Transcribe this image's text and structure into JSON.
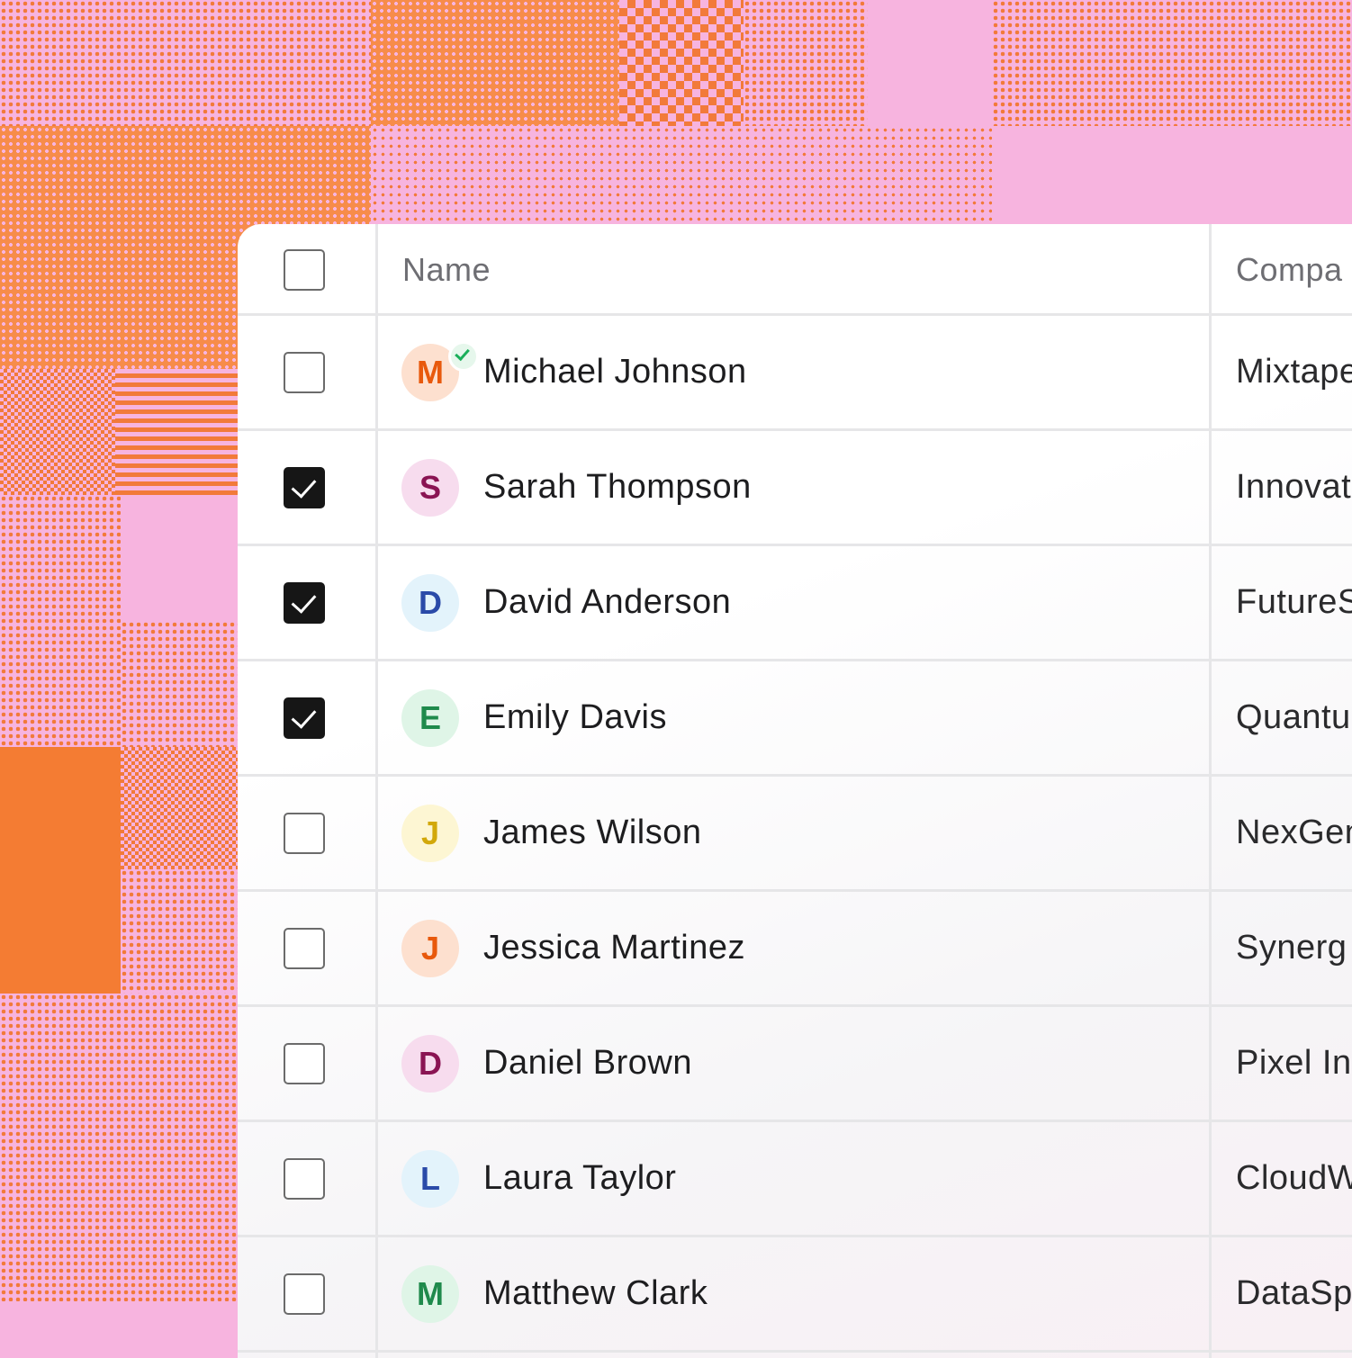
{
  "table": {
    "columns": {
      "name": "Name",
      "company": "Compa"
    },
    "rows": [
      {
        "name": "Michael Johnson",
        "initial": "M",
        "company": "Mixtape",
        "checked": false,
        "verified": true,
        "avatar_bg": "#fde0cf",
        "avatar_fg": "#e8590c"
      },
      {
        "name": "Sarah Thompson",
        "initial": "S",
        "company": "Innovat",
        "checked": true,
        "verified": false,
        "avatar_bg": "#f7dcee",
        "avatar_fg": "#8a1453"
      },
      {
        "name": "David Anderson",
        "initial": "D",
        "company": "FutureS",
        "checked": true,
        "verified": false,
        "avatar_bg": "#e3f3fb",
        "avatar_fg": "#2a4aa8"
      },
      {
        "name": "Emily Davis",
        "initial": "E",
        "company": "Quantu",
        "checked": true,
        "verified": false,
        "avatar_bg": "#dff5e7",
        "avatar_fg": "#1f8a4c"
      },
      {
        "name": "James Wilson",
        "initial": "J",
        "company": "NexGen",
        "checked": false,
        "verified": false,
        "avatar_bg": "#fdf6d3",
        "avatar_fg": "#d2a80a"
      },
      {
        "name": "Jessica Martinez",
        "initial": "J",
        "company": "Synerg",
        "checked": false,
        "verified": false,
        "avatar_bg": "#fde0cf",
        "avatar_fg": "#e8590c"
      },
      {
        "name": "Daniel Brown",
        "initial": "D",
        "company": "Pixel In",
        "checked": false,
        "verified": false,
        "avatar_bg": "#f7dcee",
        "avatar_fg": "#8a1453"
      },
      {
        "name": "Laura Taylor",
        "initial": "L",
        "company": "CloudW",
        "checked": false,
        "verified": false,
        "avatar_bg": "#e3f3fb",
        "avatar_fg": "#2a4aa8"
      },
      {
        "name": "Matthew Clark",
        "initial": "M",
        "company": "DataSp",
        "checked": false,
        "verified": false,
        "avatar_bg": "#dff5e7",
        "avatar_fg": "#1f8a4c"
      }
    ]
  }
}
